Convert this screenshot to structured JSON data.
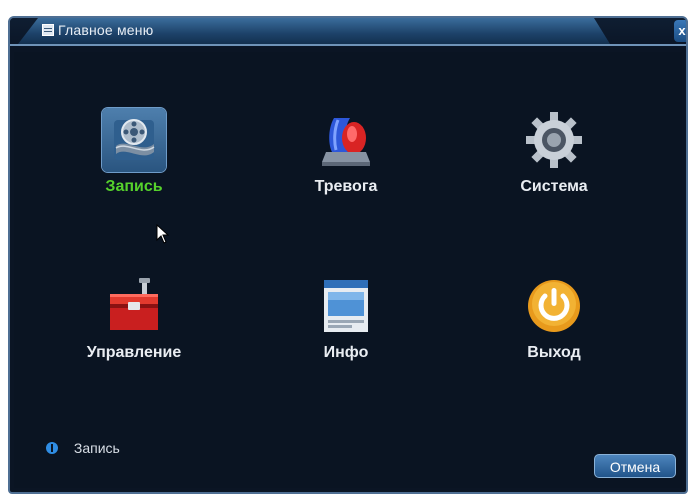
{
  "window": {
    "title": "Главное меню",
    "close_label": "x"
  },
  "menu": {
    "items": [
      {
        "label": "Запись",
        "icon": "record-film-icon",
        "selected": true
      },
      {
        "label": "Тревога",
        "icon": "alarm-siren-icon",
        "selected": false
      },
      {
        "label": "Система",
        "icon": "gear-icon",
        "selected": false
      },
      {
        "label": "Управление",
        "icon": "toolbox-icon",
        "selected": false
      },
      {
        "label": "Инфо",
        "icon": "info-window-icon",
        "selected": false
      },
      {
        "label": "Выход",
        "icon": "power-icon",
        "selected": false
      }
    ]
  },
  "status": {
    "text": "Запись",
    "icon": "info-icon"
  },
  "footer": {
    "cancel_label": "Отмена"
  },
  "colors": {
    "background": "#0b1524",
    "selected_label": "#56d22c",
    "accent": "#2f8de4"
  }
}
